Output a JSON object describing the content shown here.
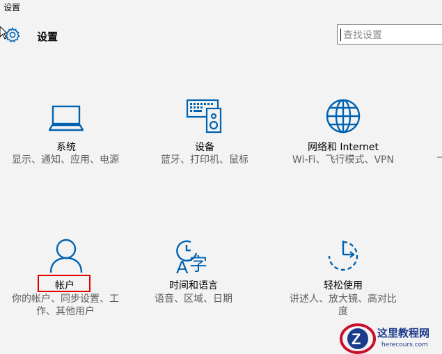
{
  "window": {
    "title": "设置"
  },
  "header": {
    "title": "设置",
    "icon": "gear-icon"
  },
  "search": {
    "placeholder": "查找设置",
    "value": ""
  },
  "tiles": [
    {
      "id": "system",
      "icon": "laptop-icon",
      "label": "系统",
      "description": "显示、通知、应用、电源"
    },
    {
      "id": "devices",
      "icon": "devices-icon",
      "label": "设备",
      "description": "蓝牙、打印机、鼠标"
    },
    {
      "id": "network",
      "icon": "globe-icon",
      "label": "网络和 Internet",
      "description": "Wi-Fi、飞行模式、VPN"
    },
    {
      "id": "accounts",
      "icon": "person-icon",
      "label": "帐户",
      "description": "你的帐户、同步设置、工作、其他用户"
    },
    {
      "id": "time-language",
      "icon": "time-language-icon",
      "label": "时间和语言",
      "description": "语音、区域、日期"
    },
    {
      "id": "ease-of-access",
      "icon": "ease-of-access-icon",
      "label": "轻松使用",
      "description": "讲述人、放大镜、高对比度"
    }
  ],
  "watermark": {
    "title": "这里教程网",
    "url": "herecours.com"
  },
  "colors": {
    "accent": "#0063b1",
    "highlight": "#e00000",
    "background": "#f3f3f3"
  }
}
